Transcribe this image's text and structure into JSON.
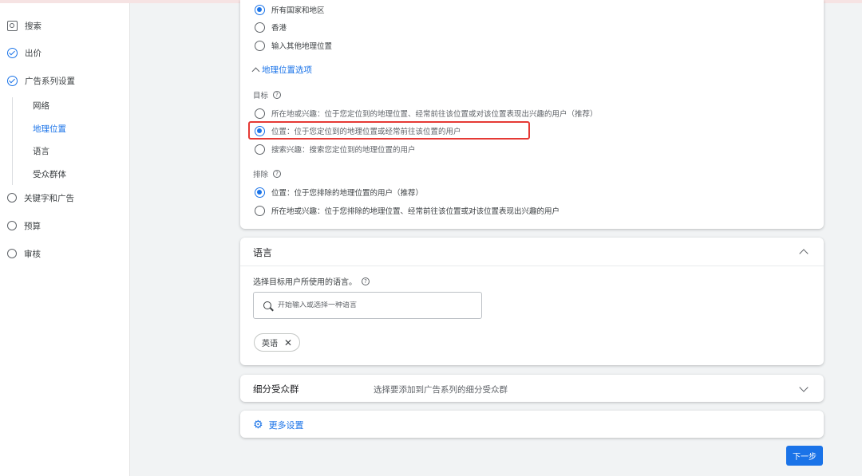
{
  "sidebar": {
    "items": [
      {
        "label": "搜索",
        "icon": "search-box-icon",
        "state": "plain"
      },
      {
        "label": "出价",
        "icon": "check-circle-icon",
        "state": "done"
      },
      {
        "label": "广告系列设置",
        "icon": "check-circle-icon",
        "state": "done"
      },
      {
        "label": "关键字和广告",
        "icon": "empty-circle-icon",
        "state": "pending"
      },
      {
        "label": "预算",
        "icon": "empty-circle-icon",
        "state": "pending"
      },
      {
        "label": "审核",
        "icon": "empty-circle-icon",
        "state": "pending"
      }
    ],
    "sub_items": [
      {
        "label": "网络",
        "active": false
      },
      {
        "label": "地理位置",
        "active": true
      },
      {
        "label": "语言",
        "active": false
      },
      {
        "label": "受众群体",
        "active": false
      }
    ]
  },
  "geo": {
    "location_options": [
      {
        "label": "所有国家和地区",
        "selected": true
      },
      {
        "label": "香港",
        "selected": false
      },
      {
        "label": "输入其他地理位置",
        "selected": false
      }
    ],
    "toggle_label": "地理位置选项",
    "target": {
      "label": "目标",
      "options": [
        {
          "label": "所在地或兴趣：位于您定位到的地理位置、经常前往该位置或对该位置表现出兴趣的用户（推荐）",
          "selected": false
        },
        {
          "label": "位置：位于您定位到的地理位置或经常前往该位置的用户",
          "selected": true
        },
        {
          "label": "搜索兴趣：搜索您定位到的地理位置的用户",
          "selected": false
        }
      ]
    },
    "exclude": {
      "label": "排除",
      "options": [
        {
          "label": "位置：位于您排除的地理位置的用户（推荐）",
          "selected": true
        },
        {
          "label": "所在地或兴趣：位于您排除的地理位置、经常前往该位置或对该位置表现出兴趣的用户",
          "selected": false
        }
      ]
    }
  },
  "language": {
    "title": "语言",
    "prompt": "选择目标用户所使用的语言。",
    "search_placeholder": "开始输入或选择一种语言",
    "chips": [
      "英语"
    ]
  },
  "audience": {
    "title": "细分受众群",
    "description": "选择要添加到广告系列的细分受众群"
  },
  "more_settings": {
    "label": "更多设置"
  },
  "next_button": {
    "label": "下一步"
  },
  "colors": {
    "accent": "#1a73e8",
    "highlight": "#e53935",
    "background": "#f1f3f4"
  }
}
